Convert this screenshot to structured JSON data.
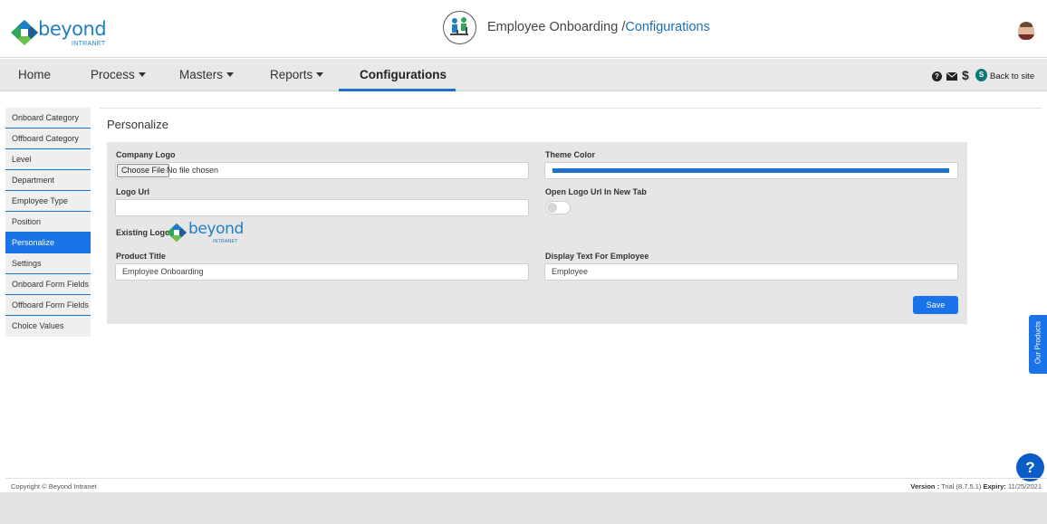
{
  "brand": {
    "name": "beyond",
    "sub": "INTRANET"
  },
  "header": {
    "app_title": "Employee Onboarding /",
    "app_title_link": "Configurations"
  },
  "nav": {
    "items": [
      {
        "label": "Home"
      },
      {
        "label": "Process"
      },
      {
        "label": "Masters"
      },
      {
        "label": "Reports"
      },
      {
        "label": "Configurations"
      }
    ],
    "back_to_site": "Back to site",
    "icons": [
      "help-icon",
      "mail-icon",
      "dollar-icon",
      "sharepoint-icon"
    ],
    "accent": "#1a73c8"
  },
  "sidebar": {
    "items": [
      {
        "label": "Onboard Category"
      },
      {
        "label": "Offboard Category"
      },
      {
        "label": "Level"
      },
      {
        "label": "Department"
      },
      {
        "label": "Employee Type"
      },
      {
        "label": "Position"
      },
      {
        "label": "Personalize"
      },
      {
        "label": "Settings"
      },
      {
        "label": "Onboard Form Fields"
      },
      {
        "label": "Offboard Form Fields"
      },
      {
        "label": "Choice Values"
      }
    ],
    "active": "Personalize"
  },
  "page": {
    "title": "Personalize",
    "company_logo_label": "Company Logo",
    "choose_file": "Choose File",
    "no_file": "No file chosen",
    "theme_color_label": "Theme Color",
    "theme_color": "#1a73c8",
    "logo_url_label": "Logo Url",
    "logo_url_value": "",
    "open_logo_label": "Open Logo Url In New Tab",
    "open_logo_enabled": false,
    "existing_logo_label": "Existing Logo:",
    "product_title_label": "Product Title",
    "product_title_value": "Employee Onboarding",
    "display_text_label": "Display Text For Employee",
    "display_text_value": "Employee",
    "save": "Save"
  },
  "side_tab": {
    "label": "Our Products"
  },
  "help_fab": {
    "label": "?"
  },
  "footer": {
    "copyright": "Copyright © Beyond Intranet",
    "version_label": "Version :",
    "version_value": "Trial (8.7.5.1)",
    "expiry_label": "Expiry:",
    "expiry_value": "11/25/2021"
  }
}
